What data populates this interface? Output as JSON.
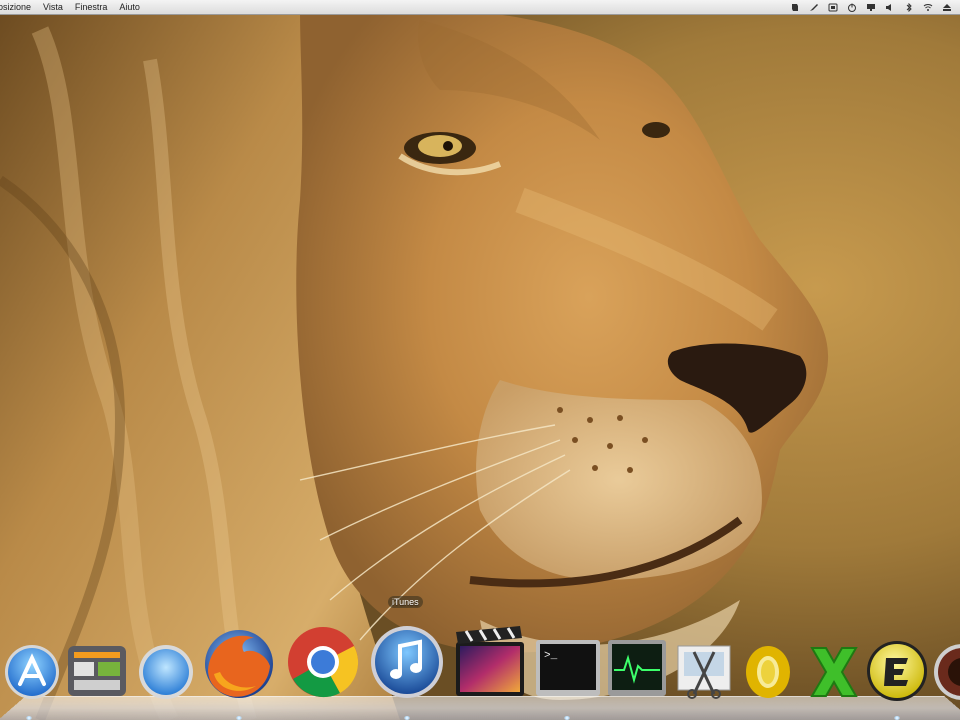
{
  "menubar": {
    "menus": [
      "osizione",
      "Vista",
      "Finestra",
      "Aiuto"
    ],
    "status_icons": [
      "evernote-icon",
      "pen-icon",
      "bluetooth-sync-icon",
      "volume-icon",
      "power-icon",
      "display-icon",
      "wifi-icon",
      "battery-icon",
      "eject-icon"
    ]
  },
  "wallpaper": {
    "subject": "lion-face-icon"
  },
  "dock": {
    "tooltip": "iTunes",
    "items": [
      {
        "name": "App Store",
        "icon": "app-store-icon"
      },
      {
        "name": "Dashboard",
        "icon": "dashboard-icon"
      },
      {
        "name": "Safari",
        "icon": "safari-icon"
      },
      {
        "name": "Firefox",
        "icon": "firefox-icon"
      },
      {
        "name": "Chrome",
        "icon": "chrome-icon"
      },
      {
        "name": "iTunes",
        "icon": "itunes-icon"
      },
      {
        "name": "Final Cut Pro",
        "icon": "final-cut-pro-icon"
      },
      {
        "name": "Terminal",
        "icon": "terminal-icon"
      },
      {
        "name": "Activity Monitor",
        "icon": "activity-monitor-icon"
      },
      {
        "name": "Grab",
        "icon": "grab-scissors-icon"
      },
      {
        "name": "Office",
        "icon": "office-icon"
      },
      {
        "name": "Excel",
        "icon": "excel-x-icon"
      },
      {
        "name": "Evernote",
        "icon": "evernote-e-icon"
      },
      {
        "name": "Camera",
        "icon": "camera-icon"
      }
    ]
  },
  "colors": {
    "menubar_bg": "#e6e6e6",
    "wallpaper_base": "#b9893f",
    "dock_glass": "#c8c8d0"
  }
}
